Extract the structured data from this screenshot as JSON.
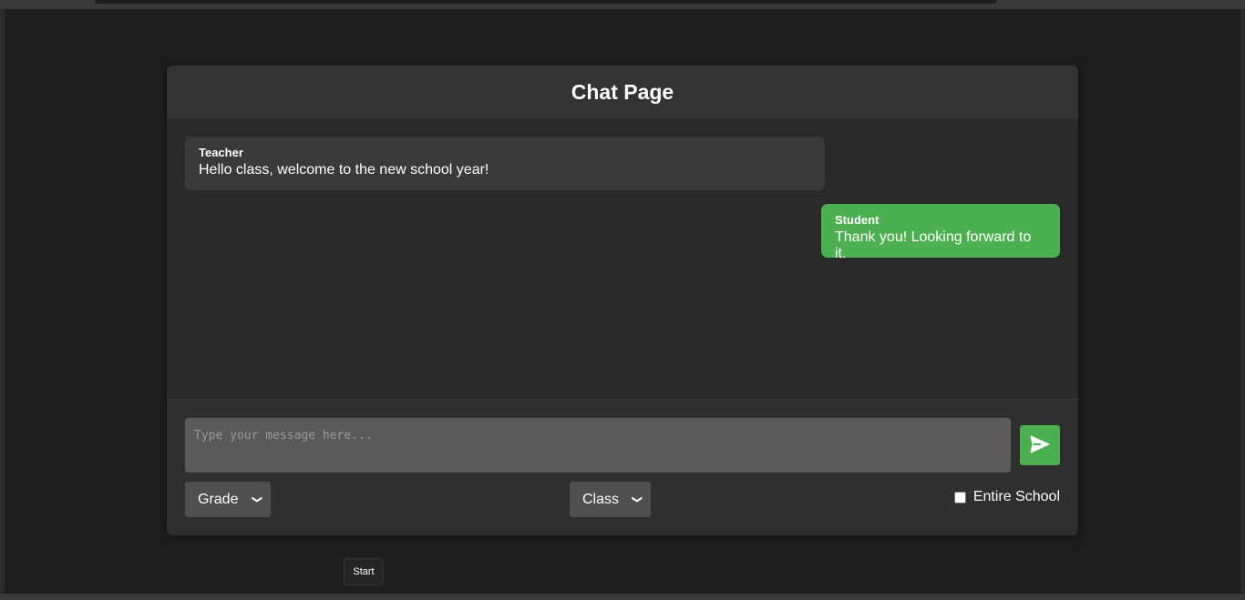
{
  "chat": {
    "title": "Chat Page",
    "messages": [
      {
        "sender": "Teacher",
        "text": "Hello class, welcome to the new school year!"
      },
      {
        "sender": "Student",
        "text": "Thank you! Looking forward to it."
      }
    ],
    "input": {
      "placeholder": "Type your message here...",
      "value": ""
    },
    "send_icon": "send-icon",
    "grade_select": {
      "selected": "Grade"
    },
    "class_select": {
      "selected": "Class"
    },
    "entire_school": {
      "label": "Entire School",
      "checked": false
    }
  },
  "start_button": {
    "label": "Start"
  },
  "colors": {
    "accent": "#4caf50",
    "background": "#1e1e1e",
    "card": "#2a2a2a",
    "header": "#333333",
    "teacher_bubble": "#3a3a3a",
    "input": "#5a5a5a"
  }
}
